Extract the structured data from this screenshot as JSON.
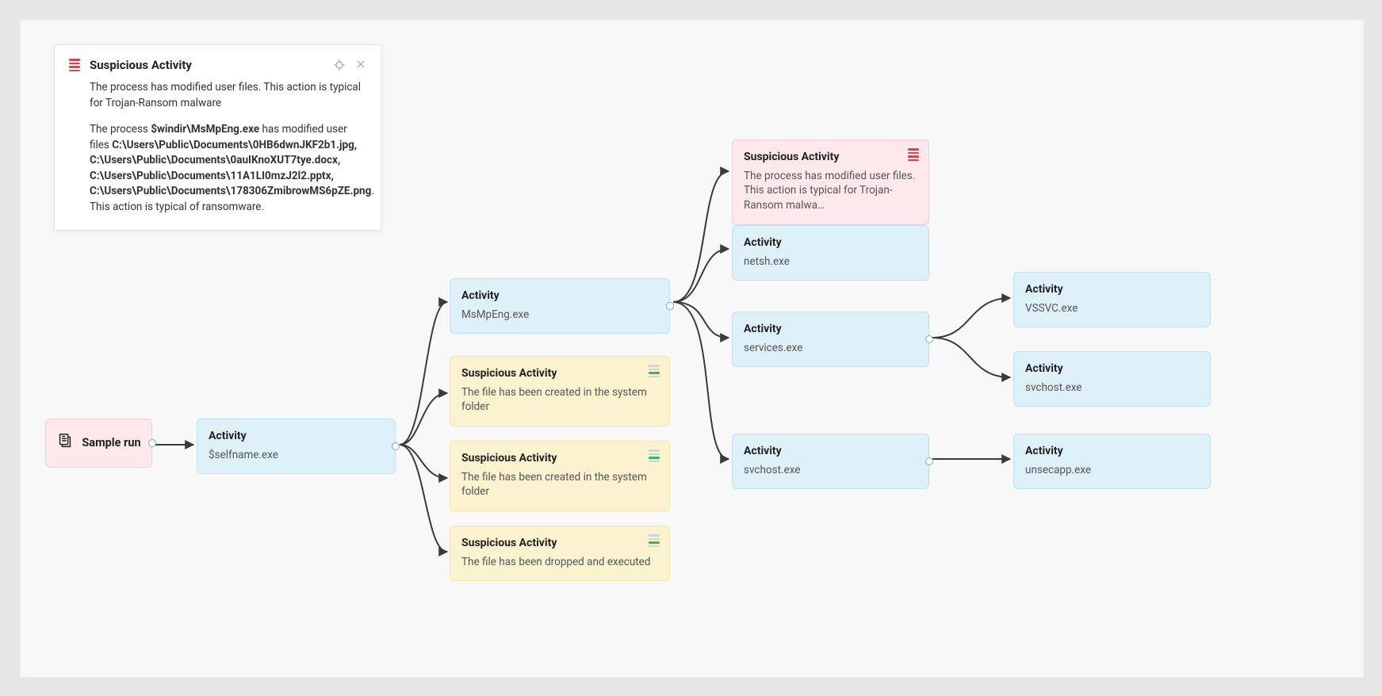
{
  "panel": {
    "title": "Suspicious Activity",
    "summary": "The process has modified user files. This action is typical for Trojan-Ransom malware",
    "detail_pre": "The process ",
    "detail_proc": "$windir\\MsMpEng.exe",
    "detail_mid": " has modified user files ",
    "detail_files": "C:\\Users\\Public\\Documents\\0HB6dwnJKF2b1.jpg, C:\\Users\\Public\\Documents\\0auIKnoXUT7tye.docx, C:\\Users\\Public\\Documents\\11A1LI0mzJ2l2.pptx, C:\\Users\\Public\\Documents\\178306ZmibrowMS6pZE.png",
    "detail_post": ". This action is typical of ransomware."
  },
  "nodes": {
    "sample_run": {
      "title": "Sample run"
    },
    "activity0": {
      "title": "Activity",
      "sub": "$selfname.exe"
    },
    "activity1": {
      "title": "Activity",
      "sub": "MsMpEng.exe"
    },
    "susp_y1": {
      "title": "Suspicious Activity",
      "sub": "The file has been created in the system folder"
    },
    "susp_y2": {
      "title": "Suspicious Activity",
      "sub": "The file has been created in the system folder"
    },
    "susp_y3": {
      "title": "Suspicious Activity",
      "sub": "The file has been dropped and executed"
    },
    "susp_pink": {
      "title": "Suspicious Activity",
      "sub": "The process has modified user files. This action is typical for Trojan-Ransom malwa…"
    },
    "act_netsh": {
      "title": "Activity",
      "sub": "netsh.exe"
    },
    "act_services": {
      "title": "Activity",
      "sub": "services.exe"
    },
    "act_svchost": {
      "title": "Activity",
      "sub": "svchost.exe"
    },
    "act_vssvc": {
      "title": "Activity",
      "sub": "VSSVC.exe"
    },
    "act_svchost2": {
      "title": "Activity",
      "sub": "svchost.exe"
    },
    "act_unsecapp": {
      "title": "Activity",
      "sub": "unsecapp.exe"
    }
  },
  "colors": {
    "link": "#3b3b3b"
  }
}
